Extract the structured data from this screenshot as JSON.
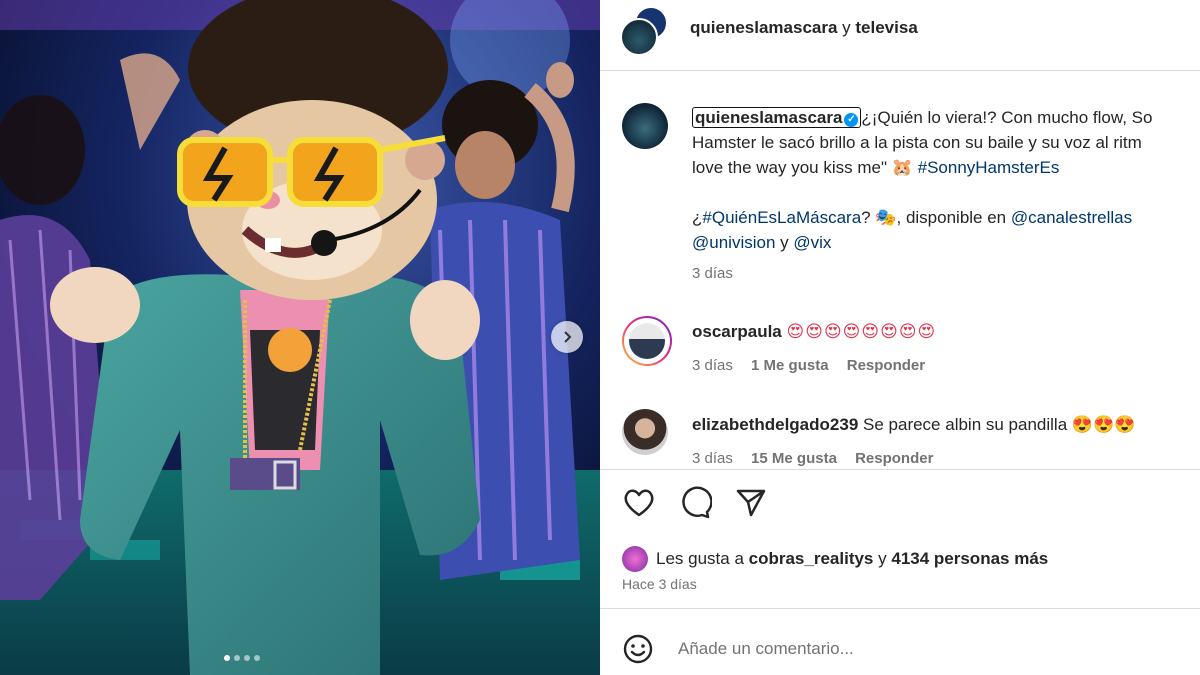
{
  "post": {
    "media": {
      "slide_count": 4,
      "active_slide": 0
    },
    "header": {
      "username": "quieneslamascara",
      "joiner": "y",
      "collaborator": "televisa"
    },
    "caption": {
      "username": "quieneslamascara",
      "line1": "¿¡Quién lo viera!? Con mucho flow, So",
      "line2": "Hamster le sacó brillo a la pista con su baile y su voz al ritm",
      "line3_text": "love the way you kiss me\" 🐹 ",
      "line3_tag": "#SonnyHamsterEs",
      "line4_a": "¿",
      "line4_tag": "#QuiénEsLaMáscara",
      "line4_b": "? 🎭, disponible en ",
      "line4_mention": "@canalestrellas",
      "line5_mention1": "@univision",
      "line5_joiner": " y ",
      "line5_mention2": "@vix",
      "time": "3 días"
    },
    "comments": [
      {
        "username": "oscarpaula",
        "text": "😍😍😍😍😍😍😍😍",
        "time": "3 días",
        "likes": "1 Me gusta",
        "reply": "Responder"
      },
      {
        "username": "elizabethdelgado239",
        "text": "Se parece albin su pandilla 😍😍😍",
        "time": "3 días",
        "likes": "15 Me gusta",
        "reply": "Responder"
      }
    ],
    "likes": {
      "prefix": "Les gusta a",
      "user": "cobras_realitys",
      "joiner": "y",
      "count": "4134 personas más"
    },
    "posted_ago": "Hace 3 días",
    "comment_input": {
      "placeholder": "Añade un comentario...",
      "value": ""
    }
  },
  "icons": [
    "chevron-right-icon",
    "heart-icon",
    "comment-icon",
    "share-icon",
    "verified-icon",
    "emoji-smile-icon"
  ],
  "colors": {
    "link": "#00376b",
    "verified": "#0095f6",
    "meta": "#737373",
    "text": "#262626"
  }
}
